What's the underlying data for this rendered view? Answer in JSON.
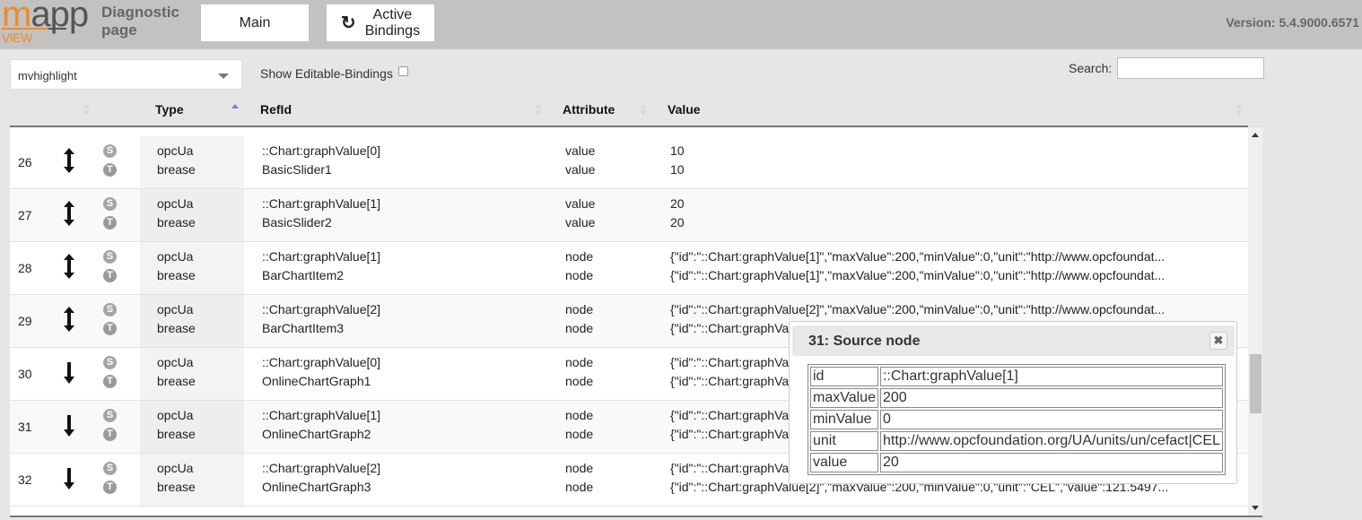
{
  "header": {
    "logo_text": "mapp",
    "logo_sub": "VIEW",
    "title_line1": "Diagnostic",
    "title_line2": "page",
    "main_button": "Main",
    "active_bindings_line1": "Active",
    "active_bindings_line2": "Bindings",
    "version": "Version: 5.4.9000.6571"
  },
  "controls": {
    "select_value": "mvhighlight",
    "show_editable_label": "Show Editable-Bindings",
    "show_editable_checked": false,
    "search_label": "Search:",
    "search_value": ""
  },
  "table": {
    "columns": [
      "",
      "Type",
      "RefId",
      "Attribute",
      "Value"
    ],
    "sorted_column": "Type",
    "sort_direction": "ascending",
    "rows": [
      {
        "index": "26",
        "direction": "both",
        "type_source": "opcUa",
        "type_target": "brease",
        "ref_source": "::Chart:graphValue[0]",
        "ref_target": "BasicSlider1",
        "attr_source": "value",
        "attr_target": "value",
        "val_source": "10",
        "val_target": "10"
      },
      {
        "index": "27",
        "direction": "both",
        "type_source": "opcUa",
        "type_target": "brease",
        "ref_source": "::Chart:graphValue[1]",
        "ref_target": "BasicSlider2",
        "attr_source": "value",
        "attr_target": "value",
        "val_source": "20",
        "val_target": "20"
      },
      {
        "index": "28",
        "direction": "both",
        "type_source": "opcUa",
        "type_target": "brease",
        "ref_source": "::Chart:graphValue[1]",
        "ref_target": "BarChartItem2",
        "attr_source": "node",
        "attr_target": "node",
        "val_source": "{\"id\":\"::Chart:graphValue[1]\",\"maxValue\":200,\"minValue\":0,\"unit\":\"http://www.opcfoundat...",
        "val_target": "{\"id\":\"::Chart:graphValue[1]\",\"maxValue\":200,\"minValue\":0,\"unit\":\"http://www.opcfoundat..."
      },
      {
        "index": "29",
        "direction": "both",
        "type_source": "opcUa",
        "type_target": "brease",
        "ref_source": "::Chart:graphValue[2]",
        "ref_target": "BarChartItem3",
        "attr_source": "node",
        "attr_target": "node",
        "val_source": "{\"id\":\"::Chart:graphValue[2]\",\"maxValue\":200,\"minValue\":0,\"unit\":\"http://www.opcfoundat...",
        "val_target": "{\"id\":\"::Chart:graphVa"
      },
      {
        "index": "30",
        "direction": "down",
        "type_source": "opcUa",
        "type_target": "brease",
        "ref_source": "::Chart:graphValue[0]",
        "ref_target": "OnlineChartGraph1",
        "attr_source": "node",
        "attr_target": "node",
        "val_source": "{\"id\":\"::Chart:graphVa",
        "val_target": "{\"id\":\"::Chart:graphVa"
      },
      {
        "index": "31",
        "direction": "down",
        "type_source": "opcUa",
        "type_target": "brease",
        "ref_source": "::Chart:graphValue[1]",
        "ref_target": "OnlineChartGraph2",
        "attr_source": "node",
        "attr_target": "node",
        "val_source": "{\"id\":\"::Chart:graphVa",
        "val_target": "{\"id\":\"::Chart:graphVa"
      },
      {
        "index": "32",
        "direction": "down",
        "type_source": "opcUa",
        "type_target": "brease",
        "ref_source": "::Chart:graphValue[2]",
        "ref_target": "OnlineChartGraph3",
        "attr_source": "node",
        "attr_target": "node",
        "val_source": "{\"id\":\"::Chart:graphVa",
        "val_target": "{\"id\":\"::Chart:graphValue[2]\",\"maxValue\":200,\"minValue\":0,\"unit\":\"CEL\",\"value\":121.5497..."
      }
    ],
    "badge_source": "S",
    "badge_target": "T"
  },
  "popup": {
    "title": "31: Source node",
    "close_icon": "close-icon",
    "rows": [
      {
        "key": "id",
        "value": "::Chart:graphValue[1]"
      },
      {
        "key": "maxValue",
        "value": "200"
      },
      {
        "key": "minValue",
        "value": "0"
      },
      {
        "key": "unit",
        "value": "http://www.opcfoundation.org/UA/units/un/cefact|CEL"
      },
      {
        "key": "value",
        "value": "20"
      }
    ]
  },
  "colors": {
    "accent_orange": "#f08a24",
    "header_bg": "#c2c2c2",
    "sort_active": "#7b7bd8"
  }
}
